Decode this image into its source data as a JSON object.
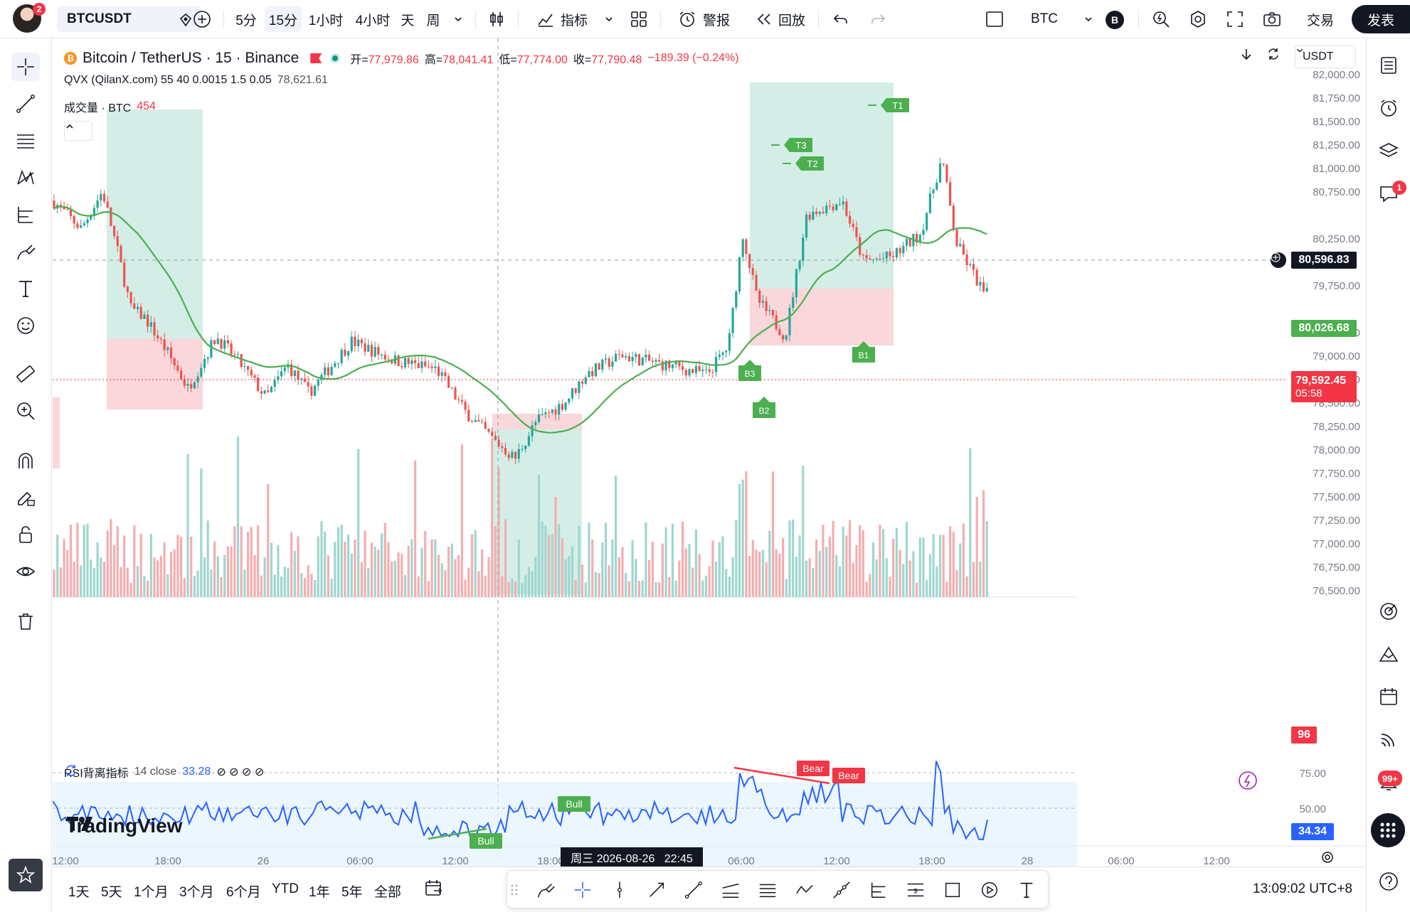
{
  "topbar": {
    "avatar_badge": "2",
    "symbol": "BTCUSDT",
    "intervals": [
      "5分",
      "15分",
      "1小时",
      "4小时",
      "天",
      "周"
    ],
    "active_interval": "15分",
    "indicators_label": "指标",
    "alert_label": "警报",
    "replay_label": "回放",
    "compare_symbol": "BTC",
    "compare_badge": "B",
    "trade_label": "交易",
    "publish_label": "发表"
  },
  "legend": {
    "title": "Bitcoin / TetherUS · 15 · Binance",
    "open_label": "开=",
    "open": "77,979.86",
    "high_label": "高=",
    "high": "78,041.41",
    "low_label": "低=",
    "low": "77,774.00",
    "close_label": "收=",
    "close": "77,790.48",
    "change": "−189.39 (−0.24%)",
    "indicator_line": "QVX (QilanX.com) 55 40 0.0015 1.5 0.05",
    "indicator_value": "78,621.61",
    "volume_label": "成交量 · BTC",
    "volume_value": "454",
    "rsi_label": "RSI背离指标",
    "rsi_params": "14 close",
    "rsi_value": "33.28",
    "currency": "USDT"
  },
  "price_axis": {
    "ticks": [
      "82,000.00",
      "81,750.00",
      "81,500.00",
      "81,250.00",
      "81,000.00",
      "80,750.00",
      "80,250.00",
      "79,750.00",
      "79,250.00",
      "79,000.00",
      "78,750.00",
      "78,500.00",
      "78,250.00",
      "78,000.00",
      "77,750.00",
      "77,500.00",
      "77,250.00",
      "77,000.00",
      "76,750.00",
      "76,500.00"
    ],
    "crosshair_price": "80,596.83",
    "ma_price": "80,026.68",
    "last_price": "79,592.45",
    "countdown": "05:58",
    "volume_tag": "96",
    "rsi_ticks": [
      "75.00",
      "50.00"
    ],
    "rsi_tag": "34.34"
  },
  "time_axis": {
    "ticks": [
      "12:00",
      "18:00",
      "26",
      "06:00",
      "12:00",
      "18:00",
      "06:00",
      "12:00",
      "18:00",
      "28",
      "06:00",
      "12:00"
    ],
    "crosshair_time": "周三 2026-08-26   22:45"
  },
  "markers": {
    "targets": [
      "T1",
      "T2",
      "T3"
    ],
    "buys": [
      "B1",
      "B2",
      "B3"
    ],
    "bull": "Bull",
    "bear": "Bear"
  },
  "watermark": "TradingView",
  "bottombar": {
    "ranges": [
      "1天",
      "5天",
      "1个月",
      "3个月",
      "6个月",
      "YTD",
      "1年",
      "5年",
      "全部"
    ],
    "clock": "13:09:02 UTC+8"
  },
  "right_sidebar": {
    "chat_badge": "1",
    "notif_badge": "99+"
  },
  "colors": {
    "up": "#26a69a",
    "down": "#ef5350",
    "ma": "#4caf50",
    "rsi": "#2962ff",
    "green_zone": "#cdebe3",
    "red_zone": "#f8d0d4"
  }
}
